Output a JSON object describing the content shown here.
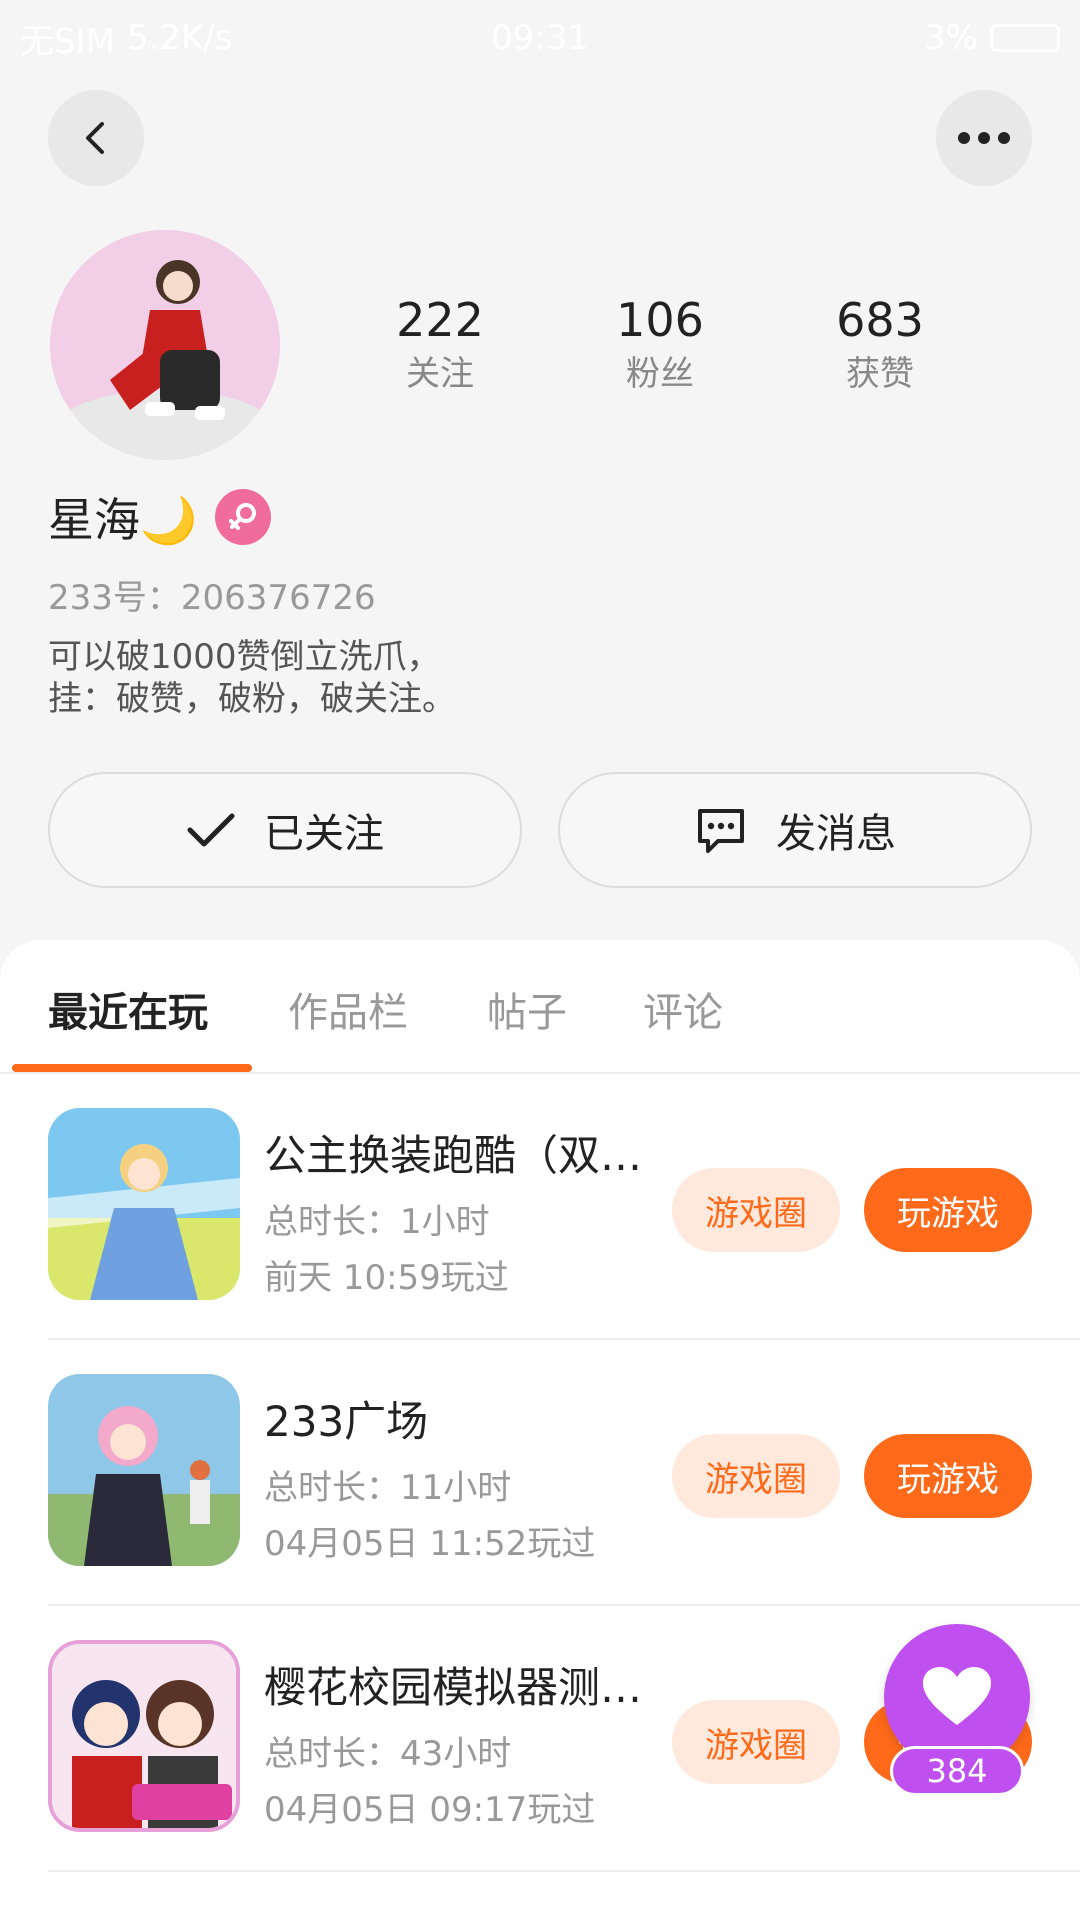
{
  "status_bar": {
    "carrier": "无SIM",
    "speed": "5.2K/s",
    "time": "09:31",
    "battery": "3%"
  },
  "profile": {
    "name": "星海🌙",
    "uid_label": "233号：",
    "uid_value": "206376726",
    "bio": [
      "可以破1000赞倒立洗爪，",
      "挂：破赞，破粉，破关注。"
    ],
    "stats": [
      {
        "value": "222",
        "label": "关注"
      },
      {
        "value": "106",
        "label": "粉丝"
      },
      {
        "value": "683",
        "label": "获赞"
      }
    ]
  },
  "actions": {
    "follow_label": "已关注",
    "message_label": "发消息"
  },
  "tabs": [
    {
      "label": "最近在玩",
      "active": true
    },
    {
      "label": "作品栏",
      "active": false
    },
    {
      "label": "帖子",
      "active": false
    },
    {
      "label": "评论",
      "active": false
    }
  ],
  "games": [
    {
      "title": "公主换装跑酷（双…",
      "duration": "总时长：1小时",
      "last_played": "前天 10:59玩过",
      "circle_label": "游戏圈",
      "play_label": "玩游戏"
    },
    {
      "title": "233广场",
      "duration": "总时长：11小时",
      "last_played": "04月05日 11:52玩过",
      "circle_label": "游戏圈",
      "play_label": "玩游戏"
    },
    {
      "title": "樱花校园模拟器测…",
      "duration": "总时长：43小时",
      "last_played": "04月05日 09:17玩过",
      "circle_label": "游戏圈",
      "play_label": "玩游戏"
    }
  ],
  "like_fab": {
    "count": "384"
  },
  "colors": {
    "accent": "#ff6a1a",
    "fab": "#c04ff0"
  }
}
